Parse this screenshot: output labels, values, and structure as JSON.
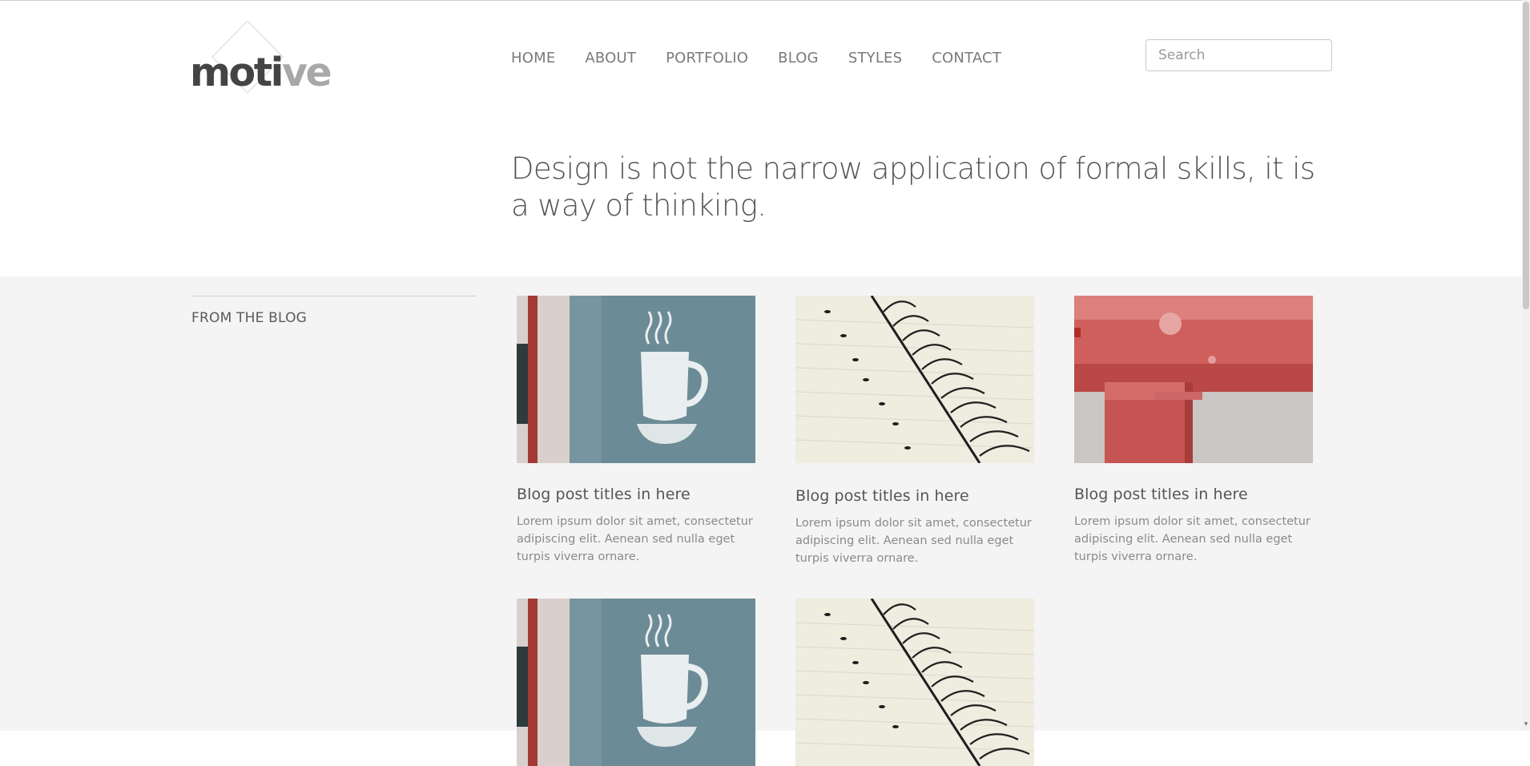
{
  "logo": {
    "text_dark": "moti",
    "text_light": "ve"
  },
  "nav": {
    "items": [
      {
        "label": "HOME"
      },
      {
        "label": "ABOUT"
      },
      {
        "label": "PORTFOLIO"
      },
      {
        "label": "BLOG"
      },
      {
        "label": "STYLES"
      },
      {
        "label": "CONTACT"
      }
    ]
  },
  "search": {
    "placeholder": "Search",
    "value": ""
  },
  "hero": {
    "quote": "Design is not the narrow application of formal skills, it is a way of thinking."
  },
  "blog": {
    "section_title": "FROM THE BLOG",
    "posts": [
      {
        "title": "Blog post titles in here",
        "excerpt": "Lorem ipsum dolor sit amet, consectetur adipiscing elit. Aenean sed nulla eget turpis viverra ornare.",
        "image": "coffee-sign"
      },
      {
        "title": "Blog post titles in here",
        "excerpt": "Lorem ipsum dolor sit amet, consectetur adipiscing elit. Aenean sed nulla eget turpis viverra ornare.",
        "image": "spiral-notebook"
      },
      {
        "title": "Blog post titles in here",
        "excerpt": "Lorem ipsum dolor sit amet, consectetur adipiscing elit. Aenean sed nulla eget turpis viverra ornare.",
        "image": "red-railing"
      },
      {
        "image": "coffee-sign"
      },
      {
        "image": "spiral-notebook"
      }
    ]
  },
  "colors": {
    "accent_text": "#555555",
    "muted_text": "#8a8a8a",
    "content_bg": "#f4f4f4"
  }
}
